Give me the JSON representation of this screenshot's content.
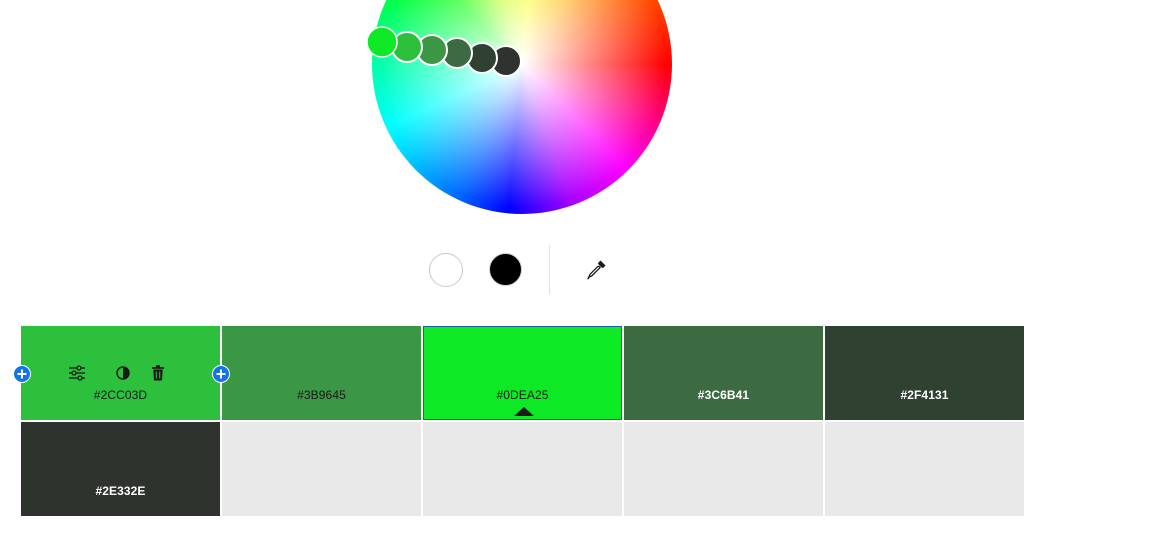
{
  "color_wheel": {
    "handles": [
      {
        "hex": "#0DEA25",
        "selected": true
      },
      {
        "hex": "#2CC03D",
        "selected": false
      },
      {
        "hex": "#3B9645",
        "selected": false
      },
      {
        "hex": "#3C6B41",
        "selected": false
      },
      {
        "hex": "#2F4131",
        "selected": false
      },
      {
        "hex": "#2E332E",
        "selected": false
      }
    ]
  },
  "tools": {
    "white_icon": "white-circle-icon",
    "black_icon": "black-circle-icon",
    "eyedropper_icon": "eyedropper-icon"
  },
  "swatches": [
    {
      "hex": "#2CC03D",
      "color": "#2CC03D",
      "text": "light",
      "active_tools": true
    },
    {
      "hex": "#3B9645",
      "color": "#3B9645",
      "text": "light"
    },
    {
      "hex": "#0DEA25",
      "color": "#0DEA25",
      "text": "light",
      "selected": true
    },
    {
      "hex": "#3C6B41",
      "color": "#3C6B41",
      "text": "dark"
    },
    {
      "hex": "#2F4131",
      "color": "#2F4131",
      "text": "dark"
    },
    {
      "hex": "#2E332E",
      "color": "#2E332E",
      "text": "dark"
    }
  ],
  "swatch_toolbar": {
    "icons": [
      "adjust-sliders-icon",
      "contrast-icon",
      "trash-icon"
    ]
  },
  "empty_cells": 4
}
